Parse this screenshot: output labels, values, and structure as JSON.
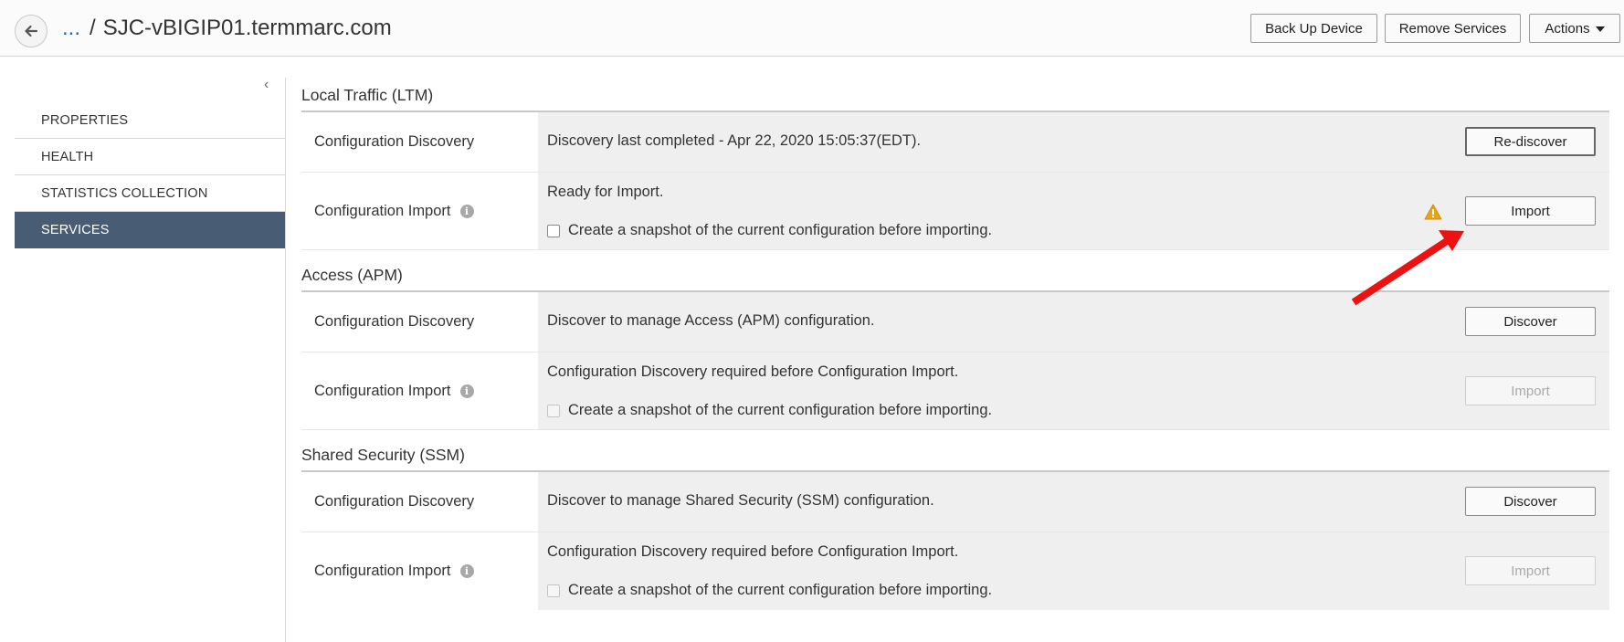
{
  "header": {
    "breadcrumb_link": "...",
    "separator": "/",
    "device_name": "SJC-vBIGIP01.termmarc.com",
    "buttons": {
      "backup": "Back Up Device",
      "remove": "Remove Services",
      "actions": "Actions"
    }
  },
  "sidebar": {
    "items": [
      {
        "label": "PROPERTIES",
        "active": false
      },
      {
        "label": "HEALTH",
        "active": false
      },
      {
        "label": "STATISTICS COLLECTION",
        "active": false
      },
      {
        "label": "SERVICES",
        "active": true
      }
    ]
  },
  "sections": [
    {
      "title": "Local Traffic (LTM)",
      "discovery": {
        "label": "Configuration Discovery",
        "text": "Discovery last completed - Apr 22, 2020 15:05:37(EDT).",
        "button": "Re-discover"
      },
      "import": {
        "label": "Configuration Import",
        "status": "Ready for Import.",
        "snapshot": "Create a snapshot of the current configuration before importing.",
        "button": "Import"
      }
    },
    {
      "title": "Access (APM)",
      "discovery": {
        "label": "Configuration Discovery",
        "text": "Discover to manage Access (APM) configuration.",
        "button": "Discover"
      },
      "import": {
        "label": "Configuration Import",
        "status": "Configuration Discovery required before Configuration Import.",
        "snapshot": "Create a snapshot of the current configuration before importing.",
        "button": "Import"
      }
    },
    {
      "title": "Shared Security (SSM)",
      "discovery": {
        "label": "Configuration Discovery",
        "text": "Discover to manage Shared Security (SSM) configuration.",
        "button": "Discover"
      },
      "import": {
        "label": "Configuration Import",
        "status": "Configuration Discovery required before Configuration Import.",
        "snapshot": "Create a snapshot of the current configuration before importing.",
        "button": "Import"
      }
    }
  ],
  "icons": {
    "back": "arrow-left-icon",
    "info": "info-icon",
    "warning": "warning-icon",
    "collapse": "chevron-left-icon"
  },
  "colors": {
    "active_nav": "#485c74",
    "link": "#1a6bb5",
    "warning": "#e8a317",
    "annotation_arrow": "#ee1111"
  }
}
